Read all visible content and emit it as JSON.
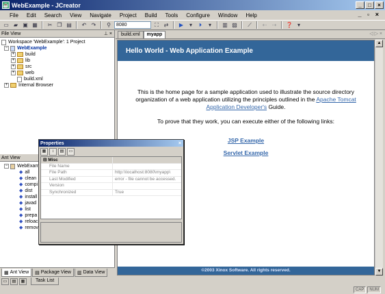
{
  "window": {
    "title": "WebExample - JCreator",
    "buttons": [
      "_",
      "□",
      "×"
    ]
  },
  "menu": [
    "File",
    "Edit",
    "Search",
    "View",
    "Navigate",
    "Project",
    "Build",
    "Tools",
    "Configure",
    "Window",
    "Help"
  ],
  "menu_mdi_controls": "_ ▫ ×",
  "toolbar": {
    "search_value": "8080"
  },
  "file_view": {
    "header": "File View",
    "pin": "⊥ ×",
    "workspace": "Workspace 'WebExample': 1 Project",
    "project": "WebExample",
    "items": [
      {
        "label": "build",
        "type": "folder"
      },
      {
        "label": "lib",
        "type": "folder"
      },
      {
        "label": "src",
        "type": "folder"
      },
      {
        "label": "web",
        "type": "folder"
      },
      {
        "label": "build.xml",
        "type": "file"
      }
    ],
    "internal_browser": "Internal Browser"
  },
  "ant_view": {
    "header": "Ant View",
    "root": "WebExam",
    "targets": [
      "all",
      "clean",
      "compi",
      "dist",
      "install",
      "javad",
      "list",
      "prepa",
      "reloac",
      "remov"
    ]
  },
  "left_tabs": [
    "Ant View",
    "Package View",
    "Data View"
  ],
  "task_tab": "Task List",
  "status": [
    "CAP",
    "NUM"
  ],
  "editor_tabs": [
    "build.xml",
    "myapp"
  ],
  "editor_arrows": "◁ ▷ ×",
  "page": {
    "banner": "Hello World - Web Application Example",
    "intro_before": "This is the home page for a sample application used to illustrate the source directory organization of a web application utilizing the principles outlined in the ",
    "intro_link": "Apache Tomcat Application Developer's",
    "intro_after": " Guide.",
    "prove": "To prove that they work, you can execute either of the following links:",
    "link1": "JSP Example",
    "link2": "Servlet Example",
    "footer": "©2003 Xinox Software. All rights reserved."
  },
  "properties": {
    "title": "Properties",
    "close": "×",
    "category": "Misc",
    "rows": [
      {
        "key": "File Name",
        "value": ""
      },
      {
        "key": "File Path",
        "value": "http:\\\\localhost:8080\\myapp\\"
      },
      {
        "key": "Last Modified",
        "value": "error - file cannot be accessed."
      },
      {
        "key": "Version",
        "value": ""
      },
      {
        "key": "Synchronized",
        "value": "True"
      }
    ]
  },
  "colors": {
    "accent": "#336699",
    "chrome": "#d4d0c8",
    "titlebar": "#0a246a"
  }
}
